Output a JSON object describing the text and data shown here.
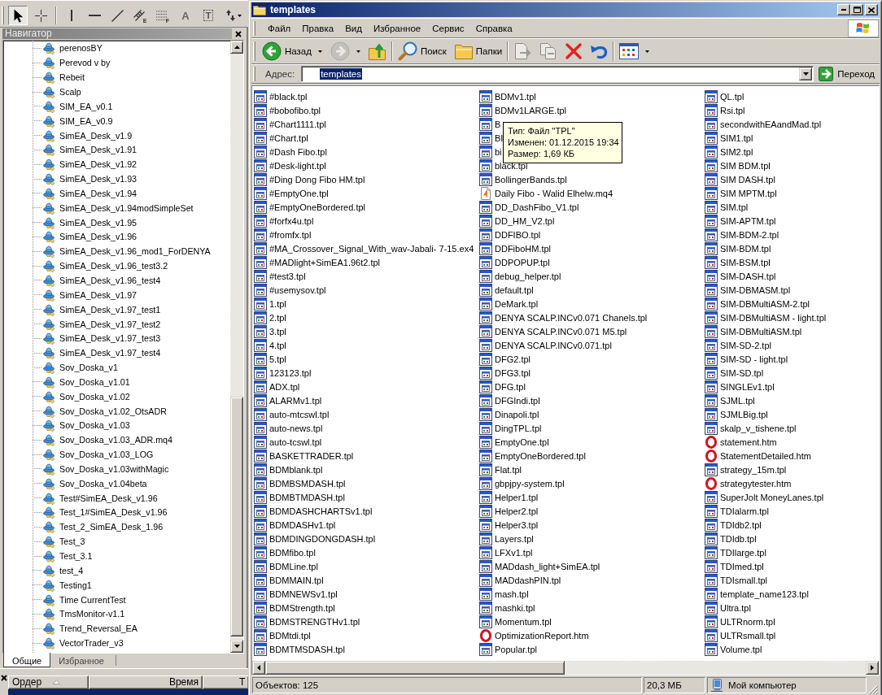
{
  "chart_toolbar": {
    "tools": [
      {
        "kind": "cursor",
        "selected": true
      },
      {
        "kind": "crosshair",
        "selected": false
      },
      {
        "kind": "separator"
      },
      {
        "kind": "vertical_line",
        "selected": false
      },
      {
        "kind": "horizontal_line",
        "selected": false
      },
      {
        "kind": "trend_line",
        "selected": false
      },
      {
        "kind": "channel",
        "label": "E",
        "selected": false
      },
      {
        "kind": "fibonacci",
        "label": "F",
        "selected": false
      },
      {
        "kind": "text",
        "label": "A",
        "selected": false
      },
      {
        "kind": "text_label",
        "label": "T",
        "selected": false
      },
      {
        "kind": "arrows",
        "selected": false
      }
    ]
  },
  "navigator": {
    "title": "Навигатор",
    "items": [
      {
        "label": "perenosBY",
        "selected": false
      },
      {
        "label": "Perevod v by",
        "selected": false
      },
      {
        "label": "Rebeit",
        "selected": false
      },
      {
        "label": "Scalp",
        "selected": false
      },
      {
        "label": "SIM_EA_v0.1",
        "selected": false
      },
      {
        "label": "SIM_EA_v0.9",
        "selected": false
      },
      {
        "label": "SimEA_Desk_v1.9",
        "selected": false
      },
      {
        "label": "SimEA_Desk_v1.91",
        "selected": false
      },
      {
        "label": "SimEA_Desk_v1.92",
        "selected": false
      },
      {
        "label": "SimEA_Desk_v1.93",
        "selected": false
      },
      {
        "label": "SimEA_Desk_v1.94",
        "selected": false
      },
      {
        "label": "SimEA_Desk_v1.94modSimpleSet",
        "selected": false
      },
      {
        "label": "SimEA_Desk_v1.95",
        "selected": false
      },
      {
        "label": "SimEA_Desk_v1.96",
        "selected": false
      },
      {
        "label": "SimEA_Desk_v1.96_mod1_ForDENYA",
        "selected": false
      },
      {
        "label": "SimEA_Desk_v1.96_test3.2",
        "selected": false
      },
      {
        "label": "SimEA_Desk_v1.96_test4",
        "selected": false
      },
      {
        "label": "SimEA_Desk_v1.97",
        "selected": false
      },
      {
        "label": "SimEA_Desk_v1.97_test1",
        "selected": false
      },
      {
        "label": "SimEA_Desk_v1.97_test2",
        "selected": false
      },
      {
        "label": "SimEA_Desk_v1.97_test3",
        "selected": false
      },
      {
        "label": "SimEA_Desk_v1.97_test4",
        "selected": false
      },
      {
        "label": "Sov_Doska_v1",
        "selected": false
      },
      {
        "label": "Sov_Doska_v1.01",
        "selected": false
      },
      {
        "label": "Sov_Doska_v1.02",
        "selected": false
      },
      {
        "label": "Sov_Doska_v1.02_OtsADR",
        "selected": false
      },
      {
        "label": "Sov_Doska_v1.03",
        "selected": false
      },
      {
        "label": "Sov_Doska_v1.03_ADR.mq4",
        "selected": false
      },
      {
        "label": "Sov_Doska_v1.03_LOG",
        "selected": false
      },
      {
        "label": "Sov_Doska_v1.03withMagic",
        "selected": false
      },
      {
        "label": "Sov_Doska_v1.04beta",
        "selected": false
      },
      {
        "label": "Test#SimEA_Desk_v1.96",
        "selected": false
      },
      {
        "label": "Test_1#SimEA_Desk_v1.96",
        "selected": false
      },
      {
        "label": "Test_2_SimEA_Desk_1.96",
        "selected": false
      },
      {
        "label": "Test_3",
        "selected": false
      },
      {
        "label": "Test_3.1",
        "selected": false
      },
      {
        "label": "test_4",
        "selected": false
      },
      {
        "label": "Testing1",
        "selected": false
      },
      {
        "label": "Time CurrentTest",
        "selected": false
      },
      {
        "label": "TmsMonitor-v1.1",
        "selected": false
      },
      {
        "label": "Trend_Reversal_EA",
        "selected": false
      },
      {
        "label": "VectorTrader_v3",
        "selected": false
      }
    ],
    "tabs": [
      {
        "label": "Общие",
        "selected": true
      },
      {
        "label": "Избранное",
        "selected": false
      }
    ]
  },
  "terminal": {
    "columns": [
      {
        "label": "Ордер",
        "sorted": true
      },
      {
        "label": "Время",
        "sorted": false
      },
      {
        "label": "Т",
        "sorted": false
      }
    ],
    "rows": [
      {
        "selected": true
      }
    ]
  },
  "explorer": {
    "title": "templates",
    "menu": [
      "Файл",
      "Правка",
      "Вид",
      "Избранное",
      "Сервис",
      "Справка"
    ],
    "toolbar": [
      {
        "kind": "back",
        "label": "Назад",
        "disabled": false,
        "dropdown": true
      },
      {
        "kind": "forward",
        "disabled": true,
        "dropdown": true
      },
      {
        "kind": "up",
        "disabled": false
      },
      {
        "kind": "separator"
      },
      {
        "kind": "search",
        "label": "Поиск",
        "disabled": false
      },
      {
        "kind": "folders",
        "label": "Папки",
        "disabled": false
      },
      {
        "kind": "separator"
      },
      {
        "kind": "move",
        "disabled": true
      },
      {
        "kind": "copy",
        "disabled": true
      },
      {
        "kind": "delete",
        "disabled": false
      },
      {
        "kind": "undo",
        "disabled": false
      },
      {
        "kind": "separator"
      },
      {
        "kind": "views",
        "disabled": false,
        "dropdown": true
      }
    ],
    "address": {
      "label": "Адрес:",
      "value": "templates",
      "text_selected": true,
      "go_label": "Переход"
    },
    "files": [
      {
        "name": "#black.tpl",
        "kind": "tpl",
        "selected": false
      },
      {
        "name": "#bobofibo.tpl",
        "kind": "tpl",
        "selected": false
      },
      {
        "name": "#Chart1111.tpl",
        "kind": "tpl",
        "selected": false
      },
      {
        "name": "#Chart.tpl",
        "kind": "tpl",
        "selected": false
      },
      {
        "name": "#Dash Fibo.tpl",
        "kind": "tpl",
        "selected": false
      },
      {
        "name": "#Desk-light.tpl",
        "kind": "tpl",
        "selected": false
      },
      {
        "name": "#Ding Dong Fibo HM.tpl",
        "kind": "tpl",
        "selected": false
      },
      {
        "name": "#EmptyOne.tpl",
        "kind": "tpl",
        "selected": false
      },
      {
        "name": "#EmptyOneBordered.tpl",
        "kind": "tpl",
        "selected": false
      },
      {
        "name": "#forfx4u.tpl",
        "kind": "tpl",
        "selected": false
      },
      {
        "name": "#fromfx.tpl",
        "kind": "tpl",
        "selected": false
      },
      {
        "name": "#MA_Crossover_Signal_With_wav-Jabali- 7-15.ex4",
        "kind": "tpl",
        "selected": false
      },
      {
        "name": "#MADlight+SimEA1.96t2.tpl",
        "kind": "tpl",
        "selected": false
      },
      {
        "name": "#test3.tpl",
        "kind": "tpl",
        "selected": false
      },
      {
        "name": "#usemysov.tpl",
        "kind": "tpl",
        "selected": false
      },
      {
        "name": "1.tpl",
        "kind": "tpl",
        "selected": false
      },
      {
        "name": "2.tpl",
        "kind": "tpl",
        "selected": false
      },
      {
        "name": "3.tpl",
        "kind": "tpl",
        "selected": false
      },
      {
        "name": "4.tpl",
        "kind": "tpl",
        "selected": false
      },
      {
        "name": "5.tpl",
        "kind": "tpl",
        "selected": false
      },
      {
        "name": "123123.tpl",
        "kind": "tpl",
        "selected": false
      },
      {
        "name": "ADX.tpl",
        "kind": "tpl",
        "selected": false
      },
      {
        "name": "ALARMv1.tpl",
        "kind": "tpl",
        "selected": false
      },
      {
        "name": "auto-mtcswl.tpl",
        "kind": "tpl",
        "selected": false
      },
      {
        "name": "auto-news.tpl",
        "kind": "tpl",
        "selected": false
      },
      {
        "name": "auto-tcswl.tpl",
        "kind": "tpl",
        "selected": false
      },
      {
        "name": "BASKETTRADER.tpl",
        "kind": "tpl",
        "selected": false
      },
      {
        "name": "BDMblank.tpl",
        "kind": "tpl",
        "selected": false
      },
      {
        "name": "BDMBSMDASH.tpl",
        "kind": "tpl",
        "selected": false
      },
      {
        "name": "BDMBTMDASH.tpl",
        "kind": "tpl",
        "selected": false
      },
      {
        "name": "BDMDASHCHARTSv1.tpl",
        "kind": "tpl",
        "selected": false
      },
      {
        "name": "BDMDASHv1.tpl",
        "kind": "tpl",
        "selected": false
      },
      {
        "name": "BDMDINGDONGDASH.tpl",
        "kind": "tpl",
        "selected": false
      },
      {
        "name": "BDMfibo.tpl",
        "kind": "tpl",
        "selected": false
      },
      {
        "name": "BDMLine.tpl",
        "kind": "tpl",
        "selected": false
      },
      {
        "name": "BDMMAIN.tpl",
        "kind": "tpl",
        "selected": false
      },
      {
        "name": "BDMNEWSv1.tpl",
        "kind": "tpl",
        "selected": false
      },
      {
        "name": "BDMStrength.tpl",
        "kind": "tpl",
        "selected": false
      },
      {
        "name": "BDMSTRENGTHv1.tpl",
        "kind": "tpl",
        "selected": false
      },
      {
        "name": "BDMtdi.tpl",
        "kind": "tpl",
        "selected": false
      },
      {
        "name": "BDMTMSDASH.tpl",
        "kind": "tpl",
        "selected": false
      },
      {
        "name": "BDMv1.tpl",
        "kind": "tpl",
        "selected": false
      },
      {
        "name": "BDMv1LARGE.tpl",
        "kind": "tpl",
        "selected": false
      },
      {
        "name": "B",
        "kind": "tpl",
        "selected": false
      },
      {
        "name": "BI",
        "kind": "tpl",
        "selected": false
      },
      {
        "name": "bi",
        "kind": "tpl",
        "selected": false
      },
      {
        "name": "black.tpl",
        "kind": "tpl",
        "selected": false
      },
      {
        "name": "BollingerBands.tpl",
        "kind": "tpl",
        "selected": false
      },
      {
        "name": "Daily Fibo - Walid Elhelw.mq4",
        "kind": "mq4",
        "selected": false
      },
      {
        "name": "DD_DashFibo_V1.tpl",
        "kind": "tpl",
        "selected": false
      },
      {
        "name": "DD_HM_V2.tpl",
        "kind": "tpl",
        "selected": false
      },
      {
        "name": "DDFIBO.tpl",
        "kind": "tpl",
        "selected": false
      },
      {
        "name": "DDFiboHM.tpl",
        "kind": "tpl",
        "selected": false
      },
      {
        "name": "DDPOPUP.tpl",
        "kind": "tpl",
        "selected": false
      },
      {
        "name": "debug_helper.tpl",
        "kind": "tpl",
        "selected": false
      },
      {
        "name": "default.tpl",
        "kind": "tpl",
        "selected": false
      },
      {
        "name": "DeMark.tpl",
        "kind": "tpl",
        "selected": false
      },
      {
        "name": "DENYA SCALP.INCv0.071 Chanels.tpl",
        "kind": "tpl",
        "selected": false
      },
      {
        "name": "DENYA SCALP.INCv0.071 M5.tpl",
        "kind": "tpl",
        "selected": false
      },
      {
        "name": "DENYA SCALP.INCv0.071.tpl",
        "kind": "tpl",
        "selected": false
      },
      {
        "name": "DFG2.tpl",
        "kind": "tpl",
        "selected": false
      },
      {
        "name": "DFG3.tpl",
        "kind": "tpl",
        "selected": false
      },
      {
        "name": "DFG.tpl",
        "kind": "tpl",
        "selected": false
      },
      {
        "name": "DFGIndi.tpl",
        "kind": "tpl",
        "selected": false
      },
      {
        "name": "Dinapoli.tpl",
        "kind": "tpl",
        "selected": false
      },
      {
        "name": "DingTPL.tpl",
        "kind": "tpl",
        "selected": false
      },
      {
        "name": "EmptyOne.tpl",
        "kind": "tpl",
        "selected": false
      },
      {
        "name": "EmptyOneBordered.tpl",
        "kind": "tpl",
        "selected": false
      },
      {
        "name": "Flat.tpl",
        "kind": "tpl",
        "selected": false
      },
      {
        "name": "gbpjpy-system.tpl",
        "kind": "tpl",
        "selected": false
      },
      {
        "name": "Helper1.tpl",
        "kind": "tpl",
        "selected": false
      },
      {
        "name": "Helper2.tpl",
        "kind": "tpl",
        "selected": false
      },
      {
        "name": "Helper3.tpl",
        "kind": "tpl",
        "selected": false
      },
      {
        "name": "Layers.tpl",
        "kind": "tpl",
        "selected": false
      },
      {
        "name": "LFXv1.tpl",
        "kind": "tpl",
        "selected": false
      },
      {
        "name": "MADdash_light+SimEA.tpl",
        "kind": "tpl",
        "selected": false
      },
      {
        "name": "MADdashPIN.tpl",
        "kind": "tpl",
        "selected": false
      },
      {
        "name": "mash.tpl",
        "kind": "tpl",
        "selected": false
      },
      {
        "name": "mashki.tpl",
        "kind": "tpl",
        "selected": false
      },
      {
        "name": "Momentum.tpl",
        "kind": "tpl",
        "selected": false
      },
      {
        "name": "OptimizationReport.htm",
        "kind": "htm",
        "selected": false
      },
      {
        "name": "Popular.tpl",
        "kind": "tpl",
        "selected": false
      },
      {
        "name": "QL.tpl",
        "kind": "tpl",
        "selected": false
      },
      {
        "name": "Rsi.tpl",
        "kind": "tpl",
        "selected": false
      },
      {
        "name": "secondwithEAandMad.tpl",
        "kind": "tpl",
        "selected": false
      },
      {
        "name": "SIM1.tpl",
        "kind": "tpl",
        "selected": false
      },
      {
        "name": "SIM2.tpl",
        "kind": "tpl",
        "selected": false
      },
      {
        "name": "SIM BDM.tpl",
        "kind": "tpl",
        "selected": false
      },
      {
        "name": "SIM DASH.tpl",
        "kind": "tpl",
        "selected": false
      },
      {
        "name": "SIM MPTM.tpl",
        "kind": "tpl",
        "selected": false
      },
      {
        "name": "SIM.tpl",
        "kind": "tpl",
        "selected": false
      },
      {
        "name": "SIM-APTM.tpl",
        "kind": "tpl",
        "selected": false
      },
      {
        "name": "SIM-BDM-2.tpl",
        "kind": "tpl",
        "selected": false
      },
      {
        "name": "SIM-BDM.tpl",
        "kind": "tpl",
        "selected": false
      },
      {
        "name": "SIM-BSM.tpl",
        "kind": "tpl",
        "selected": false
      },
      {
        "name": "SIM-DASH.tpl",
        "kind": "tpl",
        "selected": false
      },
      {
        "name": "SIM-DBMASM.tpl",
        "kind": "tpl",
        "selected": false
      },
      {
        "name": "SIM-DBMultiASM-2.tpl",
        "kind": "tpl",
        "selected": false
      },
      {
        "name": "SIM-DBMultiASM - light.tpl",
        "kind": "tpl",
        "selected": false
      },
      {
        "name": "SIM-DBMultiASM.tpl",
        "kind": "tpl",
        "selected": false
      },
      {
        "name": "SIM-SD-2.tpl",
        "kind": "tpl",
        "selected": false
      },
      {
        "name": "SIM-SD - light.tpl",
        "kind": "tpl",
        "selected": false
      },
      {
        "name": "SIM-SD.tpl",
        "kind": "tpl",
        "selected": false
      },
      {
        "name": "SINGLEv1.tpl",
        "kind": "tpl",
        "selected": false
      },
      {
        "name": "SJML.tpl",
        "kind": "tpl",
        "selected": false
      },
      {
        "name": "SJMLBig.tpl",
        "kind": "tpl",
        "selected": false
      },
      {
        "name": "skalp_v_tishene.tpl",
        "kind": "tpl",
        "selected": false
      },
      {
        "name": "statement.htm",
        "kind": "htm",
        "selected": false
      },
      {
        "name": "StatementDetailed.htm",
        "kind": "htm",
        "selected": false
      },
      {
        "name": "strategy_15m.tpl",
        "kind": "tpl",
        "selected": false
      },
      {
        "name": "strategytester.htm",
        "kind": "htm",
        "selected": false
      },
      {
        "name": "SuperJolt MoneyLanes.tpl",
        "kind": "tpl",
        "selected": false
      },
      {
        "name": "TDIalarm.tpl",
        "kind": "tpl",
        "selected": false
      },
      {
        "name": "TDIdb2.tpl",
        "kind": "tpl",
        "selected": false
      },
      {
        "name": "TDIdb.tpl",
        "kind": "tpl",
        "selected": false
      },
      {
        "name": "TDIlarge.tpl",
        "kind": "tpl",
        "selected": false
      },
      {
        "name": "TDImed.tpl",
        "kind": "tpl",
        "selected": false
      },
      {
        "name": "TDIsmall.tpl",
        "kind": "tpl",
        "selected": false
      },
      {
        "name": "template_name123.tpl",
        "kind": "tpl",
        "selected": false
      },
      {
        "name": "Ultra.tpl",
        "kind": "tpl",
        "selected": false
      },
      {
        "name": "ULTRnorm.tpl",
        "kind": "tpl",
        "selected": false
      },
      {
        "name": "ULTRsmall.tpl",
        "kind": "tpl",
        "selected": false
      },
      {
        "name": "Volume.tpl",
        "kind": "tpl",
        "selected": false
      }
    ],
    "tooltip": {
      "lines": [
        "Тип: Файл \"TPL\"",
        "Изменен: 01.12.2015 19:34",
        "Размер: 1,69 КБ"
      ]
    },
    "status_bar": {
      "objects": "Объектов: 125",
      "size": "20,3 МБ",
      "zone": "Мой компьютер"
    }
  }
}
